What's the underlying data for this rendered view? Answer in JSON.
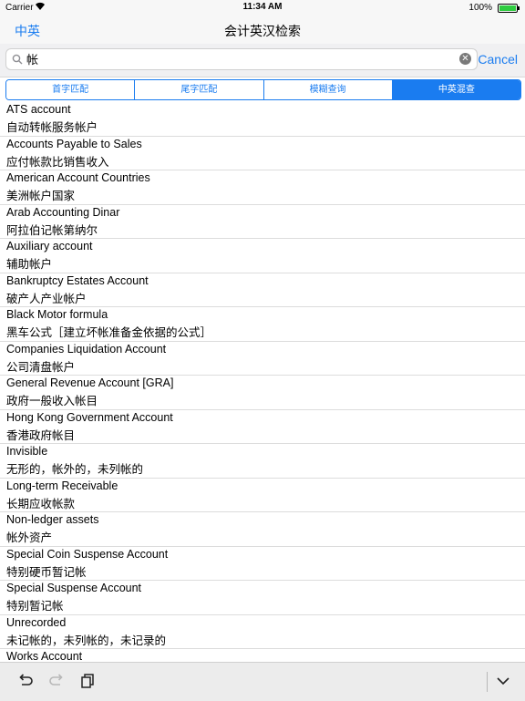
{
  "status_bar": {
    "carrier": "Carrier",
    "time": "11:34 AM",
    "battery_percent": "100%",
    "battery_level": 1.0
  },
  "nav": {
    "lang_button": "中英",
    "title": "会计英汉检索"
  },
  "search": {
    "value": "帐",
    "placeholder": "",
    "cancel_label": "Cancel"
  },
  "segments": [
    {
      "label": "首字匹配",
      "active": false
    },
    {
      "label": "尾字匹配",
      "active": false
    },
    {
      "label": "模糊查询",
      "active": false
    },
    {
      "label": "中英混查",
      "active": true
    }
  ],
  "entries": [
    {
      "en": "ATS account",
      "zh": "自动转帐服务帐户"
    },
    {
      "en": "Accounts Payable to Sales",
      "zh": "应付帐款比销售收入"
    },
    {
      "en": "American Account Countries",
      "zh": "美洲帐户国家"
    },
    {
      "en": "Arab Accounting Dinar",
      "zh": "阿拉伯记帐第纳尔"
    },
    {
      "en": "Auxiliary account",
      "zh": "辅助帐户"
    },
    {
      "en": "Bankruptcy Estates Account",
      "zh": "破产人产业帐户"
    },
    {
      "en": "Black Motor formula",
      "zh": "黑车公式［建立坏帐准备金依据的公式］"
    },
    {
      "en": "Companies Liquidation Account",
      "zh": "公司清盘帐户"
    },
    {
      "en": "General Revenue Account [GRA]",
      "zh": "政府一般收入帐目"
    },
    {
      "en": "Hong Kong Government Account",
      "zh": "香港政府帐目"
    },
    {
      "en": "Invisible",
      "zh": "无形的，帐外的，未列帐的"
    },
    {
      "en": "Long-term Receivable",
      "zh": "长期应收帐款"
    },
    {
      "en": "Non-ledger assets",
      "zh": "帐外资产"
    },
    {
      "en": "Special Coin Suspense Account",
      "zh": "特别硬币暂记帐"
    },
    {
      "en": "Special Suspense Account",
      "zh": "特别暂记帐"
    },
    {
      "en": "Unrecorded",
      "zh": "未记帐的，未列帐的，未记录的"
    },
    {
      "en": "Works Account",
      "zh": ""
    }
  ],
  "toolbar": {
    "icons": [
      "undo-icon",
      "redo-icon",
      "paste-icon",
      "keyboard-dismiss-icon"
    ]
  },
  "colors": {
    "accent": "#1a7cf0"
  }
}
